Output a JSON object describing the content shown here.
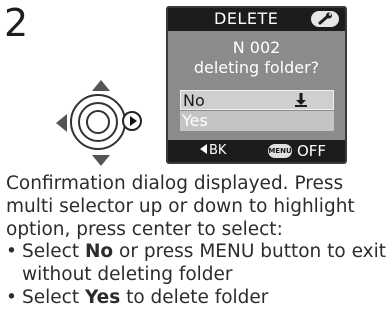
{
  "step": "2",
  "screen": {
    "title": "DELETE",
    "line1": "N 002",
    "line2": "deleting folder?",
    "options": [
      "No",
      "Yes"
    ],
    "footer_back": "BK",
    "footer_menu": "MENU",
    "footer_off": "OFF",
    "icons": {
      "header": "wrench-icon",
      "selected": "hand-pointer-icon",
      "back": "left-arrow-icon"
    }
  },
  "selector": {
    "icon": "multi-selector-icon"
  },
  "description": "Confirmation dialog displayed.  Press multi selector up or down to highlight option, press center to select:",
  "bullets": [
    {
      "pre": "Select ",
      "bold": "No",
      "post": " or press MENU button to exit without deleting folder"
    },
    {
      "pre": "Select ",
      "bold": "Yes",
      "post": " to delete folder"
    }
  ]
}
